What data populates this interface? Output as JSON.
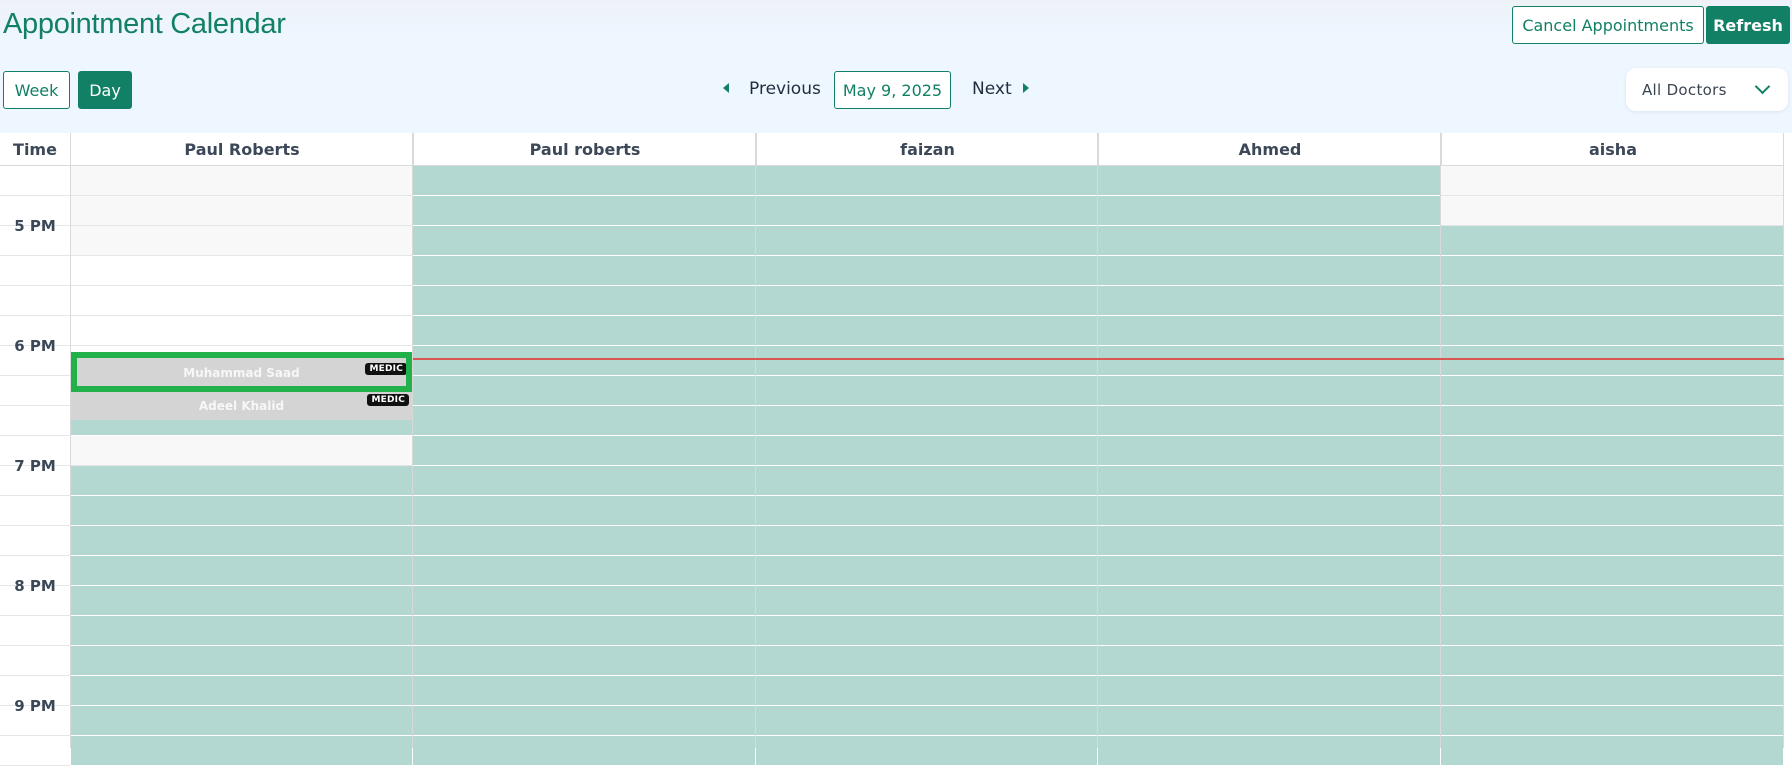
{
  "header": {
    "title": "Appointment Calendar",
    "cancel_label": "Cancel Appointments",
    "refresh_label": "Refresh"
  },
  "toolbar": {
    "view_week": "Week",
    "view_day": "Day",
    "active_view": "Day",
    "previous_label": "Previous",
    "current_date": "May 9, 2025",
    "next_label": "Next",
    "doctor_filter": "All Doctors"
  },
  "calendar": {
    "time_header": "Time",
    "doctors": [
      "Paul Roberts",
      "Paul roberts",
      "faizan",
      "Ahmed",
      "aisha"
    ],
    "time_labels": [
      "5 PM",
      "6 PM",
      "7 PM",
      "8 PM",
      "9 PM"
    ],
    "appointments": [
      {
        "patient": "Muhammad Saad",
        "badge": "MEDIC",
        "doctor": "Paul Roberts",
        "selected": true
      },
      {
        "patient": "Adeel Khalid",
        "badge": "MEDIC",
        "doctor": "Paul Roberts",
        "selected": false
      }
    ]
  },
  "colors": {
    "brand": "#128064",
    "available_slot": "#b3d8d1",
    "current_time_line": "#d8574f",
    "selection_outline": "#22b04b",
    "appointment_fill": "#d4d4d4"
  },
  "icons": {
    "previous": "caret-left-icon",
    "next": "caret-right-icon",
    "dropdown": "chevron-down-icon"
  }
}
